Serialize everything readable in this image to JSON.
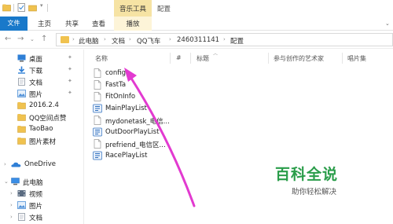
{
  "titlebar": {
    "context_tab": "音乐工具",
    "window_title": "配置"
  },
  "ribbon": {
    "tabs": [
      {
        "label": "文件"
      },
      {
        "label": "主页"
      },
      {
        "label": "共享"
      },
      {
        "label": "查看"
      },
      {
        "label": "播放"
      }
    ]
  },
  "address": {
    "breadcrumbs": [
      "此电脑",
      "文档",
      "QQ飞车",
      "2460311141",
      "配置"
    ]
  },
  "nav": {
    "items": [
      {
        "label": "桌面",
        "icon": "desktop-icon",
        "color": "#2f7fd6",
        "pinned": true
      },
      {
        "label": "下载",
        "icon": "download-icon",
        "color": "#2f7fd6",
        "pinned": true
      },
      {
        "label": "文档",
        "icon": "document-icon",
        "color": "#9aa4b1",
        "pinned": true
      },
      {
        "label": "图片",
        "icon": "picture-icon",
        "color": "#4e90d8",
        "pinned": true
      },
      {
        "label": "2016.2.4",
        "icon": "folder-icon",
        "color": "#f0c24f",
        "pinned": false
      },
      {
        "label": "QQ空间点赞",
        "icon": "folder-icon",
        "color": "#f0c24f",
        "pinned": false
      },
      {
        "label": "TaoBao",
        "icon": "folder-icon",
        "color": "#f0c24f",
        "pinned": false
      },
      {
        "label": "图片素材",
        "icon": "folder-icon",
        "color": "#f0c24f",
        "pinned": false
      },
      {
        "label": "OneDrive",
        "icon": "onedrive-icon",
        "color": "#2f7fd6",
        "pinned": false
      },
      {
        "label": "此电脑",
        "icon": "computer-icon",
        "color": "#3a8ee6",
        "pinned": false
      },
      {
        "label": "视频",
        "icon": "video-icon",
        "color": "#5a6b80",
        "pinned": false
      },
      {
        "label": "图片",
        "icon": "picture-icon",
        "color": "#4e90d8",
        "pinned": false
      },
      {
        "label": "文档",
        "icon": "document-icon",
        "color": "#9aa4b1",
        "pinned": false
      }
    ]
  },
  "columns": [
    "名称",
    "#",
    "标题",
    "参与创作的艺术家",
    "唱片集"
  ],
  "files": [
    {
      "name": "config",
      "icon": "file-icon"
    },
    {
      "name": "FastTa",
      "icon": "file-icon"
    },
    {
      "name": "FitOnInfo",
      "icon": "file-icon"
    },
    {
      "name": "MainPlayList",
      "icon": "playlist-icon"
    },
    {
      "name": "mydonetask_电信...",
      "icon": "file-icon"
    },
    {
      "name": "OutDoorPlayList",
      "icon": "playlist-icon"
    },
    {
      "name": "prefriend_电信区...",
      "icon": "file-icon"
    },
    {
      "name": "RacePlayList",
      "icon": "playlist-icon"
    }
  ],
  "watermark": {
    "logo": "百科全说",
    "tagline": "助你轻松解决"
  },
  "colors": {
    "accent": "#1979ca",
    "context_tab": "#f6e3a4",
    "annotation_arrow": "#e23ad0",
    "watermark": "#2a9d4a"
  }
}
